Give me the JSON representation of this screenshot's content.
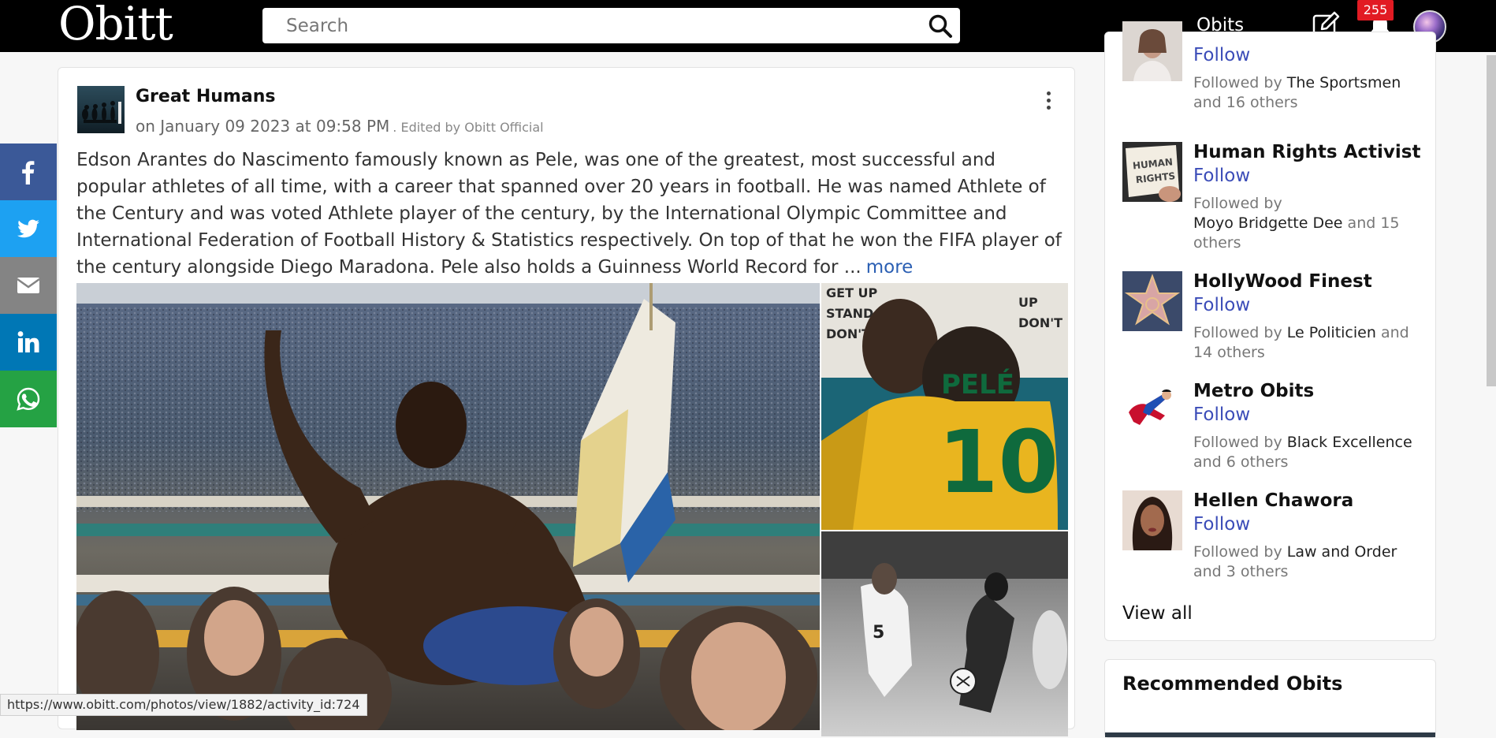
{
  "header": {
    "logo": "Obitt",
    "search_placeholder": "Search",
    "nav_obits": "Obits",
    "notification_count": "255"
  },
  "share": {
    "items": [
      "facebook",
      "twitter",
      "email",
      "linkedin",
      "whatsapp"
    ],
    "colors": [
      "#3b5998",
      "#1da1f2",
      "#848484",
      "#0077b5",
      "#25a244"
    ]
  },
  "post": {
    "author": "Great Humans",
    "date": "on January 09 2023 at 09:58 PM",
    "edited": ". Edited by Obitt Official",
    "text": "Edson Arantes do Nascimento famously known as Pele, was one of the greatest, most successful and popular athletes of all time, with a career that spanned over 20 years in football. He was named Athlete of the Century and was voted Athlete player of the century, by the International Olympic Committee and International Federation of Football History & Statistics respectively. On top of that he won the FIFA player of the century alongside Diego Maradona. Pele also holds a Guinness World Record for ...",
    "more": "more",
    "jersey_text": "PELÉ",
    "jersey_number": "10"
  },
  "sidebar": {
    "suggestions": [
      {
        "name": "",
        "follow": "Follow",
        "followed_by": "Followed by",
        "who": "The Sportsmen",
        "others": "and 16 others"
      },
      {
        "name": "Human Rights Activist",
        "follow": "Follow",
        "followed_by": "Followed by",
        "who": "Moyo Bridgette Dee",
        "others": "and 15 others"
      },
      {
        "name": "HollyWood Finest",
        "follow": "Follow",
        "followed_by": "Followed by",
        "who": "Le Politicien",
        "others": "and 14 others"
      },
      {
        "name": "Metro Obits",
        "follow": "Follow",
        "followed_by": "Followed by",
        "who": "Black Excellence",
        "others": "and 6 others"
      },
      {
        "name": "Hellen Chawora",
        "follow": "Follow",
        "followed_by": "Followed by",
        "who": "Law and Order",
        "others": "and 3 others"
      }
    ],
    "view_all": "View all",
    "recommended_title": "Recommended Obits"
  },
  "status_url": "https://www.obitt.com/photos/view/1882/activity_id:724",
  "colors": {
    "accent": "#3b4cb8",
    "more_link": "#2b5fb3",
    "badge": "#e21b23",
    "topbar": "#000000"
  }
}
